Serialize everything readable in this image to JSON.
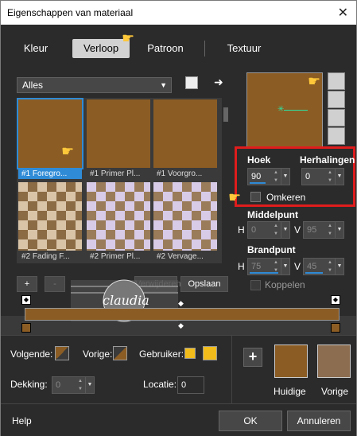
{
  "window": {
    "title": "Eigenschappen van materiaal",
    "close": "✕"
  },
  "tabs": [
    {
      "label": "Kleur"
    },
    {
      "label": "Verloop"
    },
    {
      "label": "Patroon"
    },
    {
      "label": "Textuur"
    }
  ],
  "gallery": {
    "category": "Alles",
    "items": [
      {
        "label": "#1 Foregro..."
      },
      {
        "label": "#1 Primer Pl..."
      },
      {
        "label": "#1 Voorgro..."
      },
      {
        "label": "#2 Fading F..."
      },
      {
        "label": "#2 Primer Pl..."
      },
      {
        "label": "#2 Vervage..."
      }
    ]
  },
  "controls": {
    "hoek_label": "Hoek",
    "hoek_value": "90",
    "herhalingen_label": "Herhalingen",
    "herhalingen_value": "0",
    "omkeren_label": "Omkeren",
    "middelpunt_label": "Middelpunt",
    "mid_h_label": "H",
    "mid_h_value": "0",
    "mid_v_label": "V",
    "mid_v_value": "95",
    "brandpunt_label": "Brandpunt",
    "brand_h_label": "H",
    "brand_h_value": "75",
    "brand_v_label": "V",
    "brand_v_value": "45",
    "koppelen_label": "Koppelen"
  },
  "editor": {
    "add": "+",
    "remove": "-",
    "verwijderen": "Verwijderen",
    "opslaan": "Opslaan",
    "watermark": "claudia"
  },
  "bottom": {
    "volgende_label": "Volgende:",
    "vorige_label": "Vorige:",
    "gebruiker_label": "Gebruiker:",
    "dekking_label": "Dekking:",
    "dekking_value": "0",
    "locatie_label": "Locatie:",
    "locatie_value": "0",
    "plus": "+",
    "huidige_label": "Huidige",
    "vorige2_label": "Vorige"
  },
  "footer": {
    "help": "Help",
    "ok": "OK",
    "annuleren": "Annuleren"
  },
  "colors": {
    "gradient": "#8b5d24",
    "accent": "#2f8bd6",
    "highlight": "#e01c1c",
    "user_swatch": "#f2bd1a",
    "vorige_swatch": "#8c6d50"
  }
}
